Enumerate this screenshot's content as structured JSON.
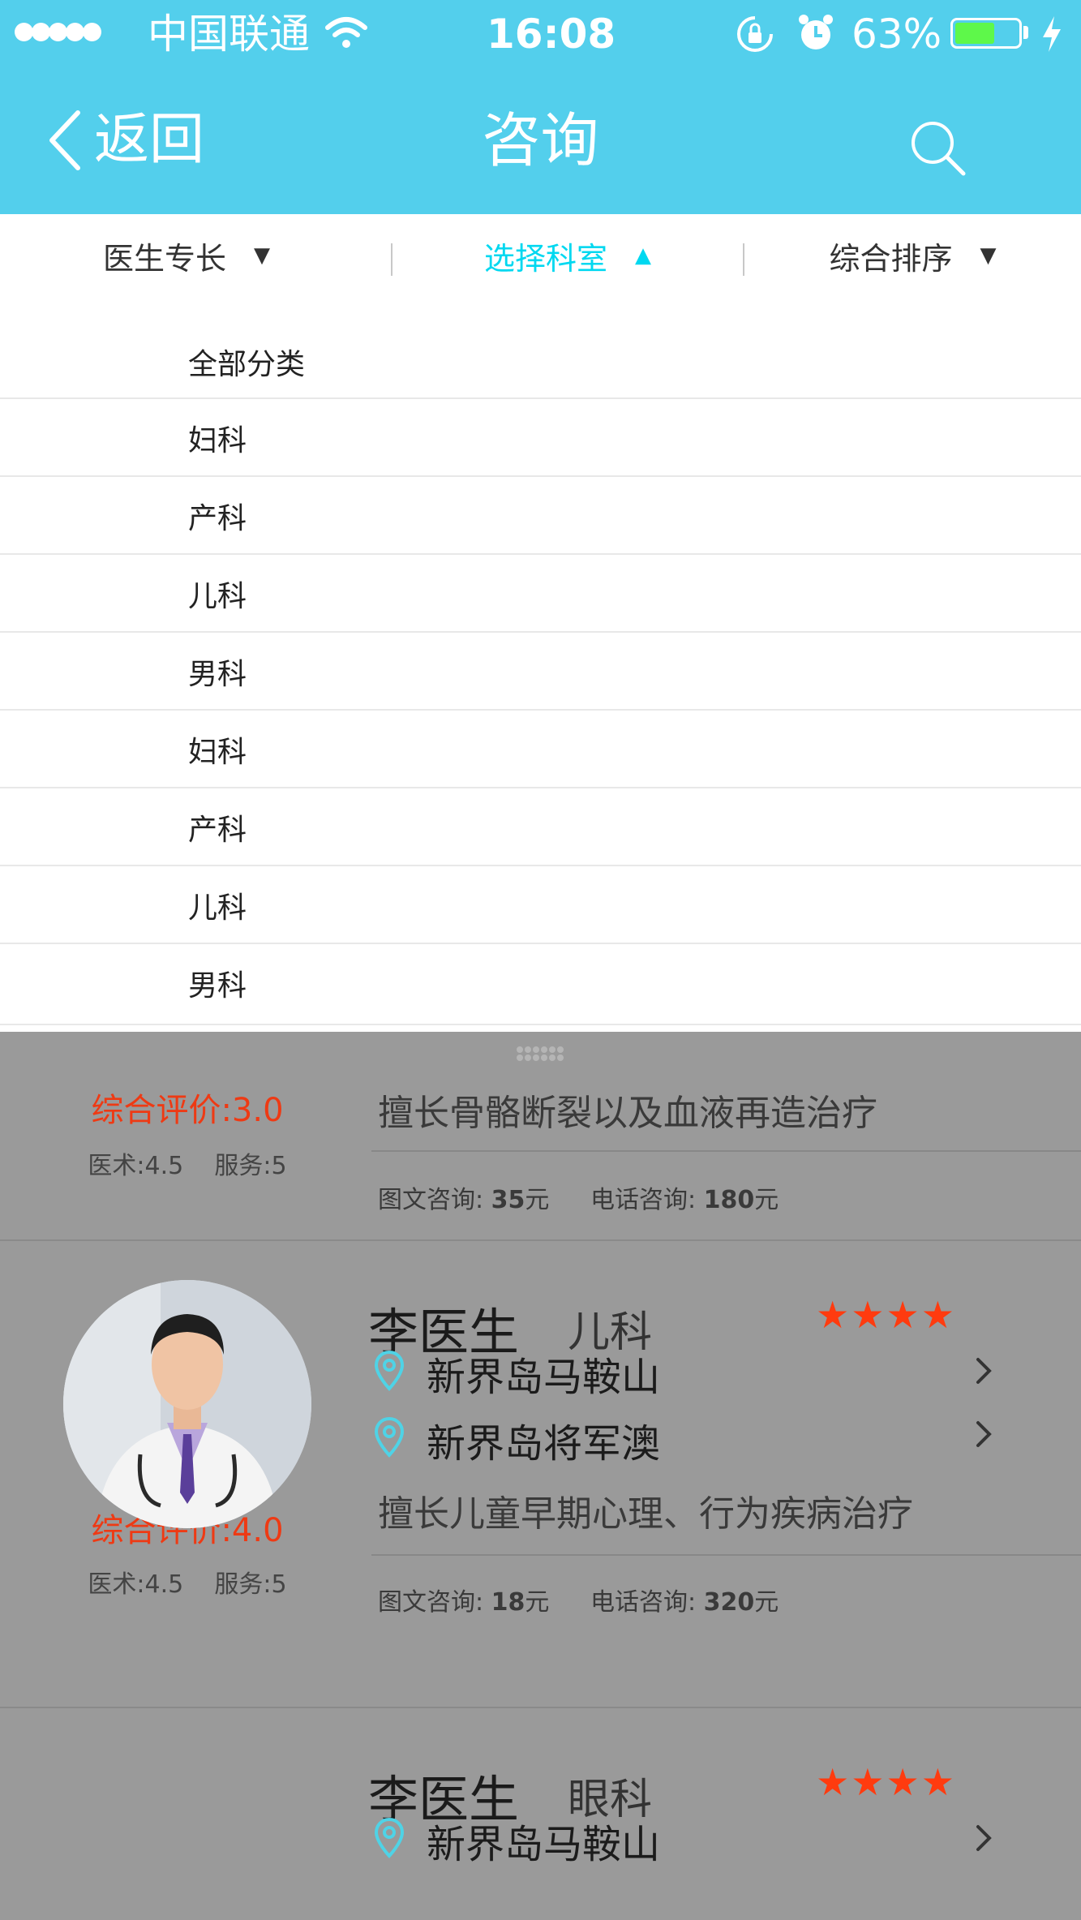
{
  "status_bar": {
    "carrier": "中国联通",
    "time": "16:08",
    "battery": "63%",
    "battery_level": 0.63
  },
  "nav": {
    "back_label": "返回",
    "title": "咨询"
  },
  "filters": [
    {
      "label": "医生专长",
      "arrow": "▼"
    },
    {
      "label": "选择科室",
      "arrow": "▲"
    },
    {
      "label": "综合排序",
      "arrow": "▼"
    }
  ],
  "dropdown": {
    "items": [
      "全部分类",
      "妇科",
      "产科",
      "儿科",
      "男科",
      "妇科",
      "产科",
      "儿科",
      "男科"
    ]
  },
  "doctors": [
    {
      "rating": "综合评价:3.0",
      "skill_score": "医术:4.5",
      "service_score": "服务:5",
      "specialty": "擅长骨骼断裂以及血液再造治疗",
      "text_consult_label": "图文咨询:",
      "text_consult_price": "35",
      "phone_consult_label": "电话咨询:",
      "phone_consult_price": "180",
      "currency": "元"
    },
    {
      "name": "李医生",
      "department": "儿科",
      "stars": "★★★★",
      "locations": [
        "新界岛马鞍山",
        "新界岛将军澳"
      ],
      "rating": "综合评价:4.0",
      "skill_score": "医术:4.5",
      "service_score": "服务:5",
      "specialty": "擅长儿童早期心理、行为疾病治疗",
      "text_consult_label": "图文咨询:",
      "text_consult_price": "18",
      "phone_consult_label": "电话咨询:",
      "phone_consult_price": "320",
      "currency": "元"
    },
    {
      "name": "李医生",
      "department": "眼科",
      "stars": "★★★★",
      "locations": [
        "新界岛马鞍山"
      ]
    }
  ],
  "colors": {
    "header": "#53cfec",
    "active_filter": "#00d8f0",
    "rating": "#ee3a14",
    "stars": "#ff3b0f",
    "pin": "#4fd3e6"
  }
}
